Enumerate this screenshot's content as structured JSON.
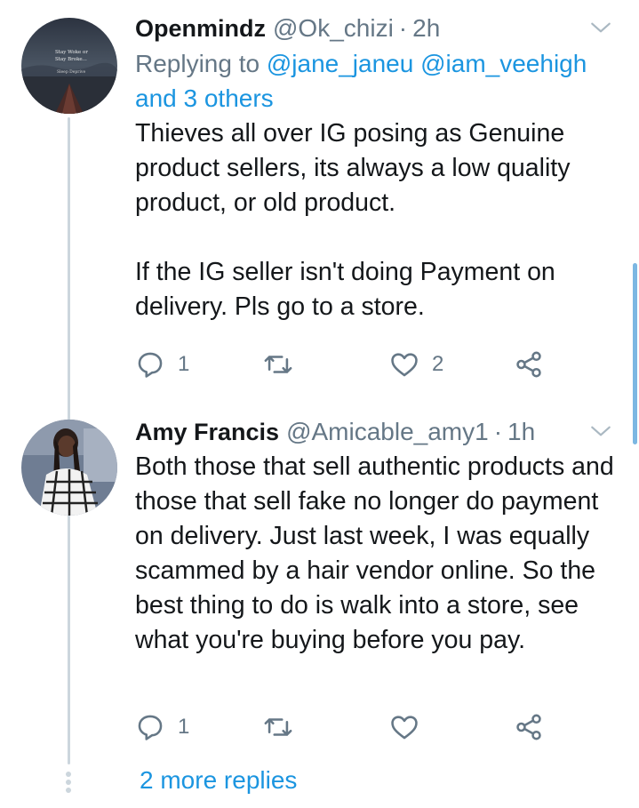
{
  "tweets": [
    {
      "display_name": "Openmindz",
      "handle": "@Ok_chizi",
      "separator": "·",
      "time": "2h",
      "reply_prefix": "Replying to",
      "mentions": [
        "@jane_janeu",
        "@iam_veehigh"
      ],
      "others": "and 3 others",
      "text": "Thieves all over IG posing as Genuine product sellers, its always a low quality product, or old product.\n\nIf the IG seller isn't doing Payment on delivery. Pls go to a store.",
      "avatar_text": [
        "Stay Woke or",
        "Stay Broke...",
        "Sleep Deprive"
      ],
      "reply_count": "1",
      "like_count": "2"
    },
    {
      "display_name": "Amy Francis",
      "handle": "@Amicable_amy1",
      "separator": "·",
      "time": "1h",
      "text": "Both those that sell authentic products and those that sell fake no longer do payment on delivery. Just last week, I was equally scammed by a hair vendor online. So the best thing to do is walk into a store, see what you're buying before you pay.",
      "reply_count": "1"
    }
  ],
  "more_replies": "2 more replies",
  "icons": {
    "caret": "chevron-down-icon",
    "reply": "reply-icon",
    "retweet": "retweet-icon",
    "like": "heart-icon",
    "share": "share-icon"
  },
  "colors": {
    "link": "#1b95e0",
    "muted": "#657786",
    "thread_line": "#ccd6dd"
  }
}
